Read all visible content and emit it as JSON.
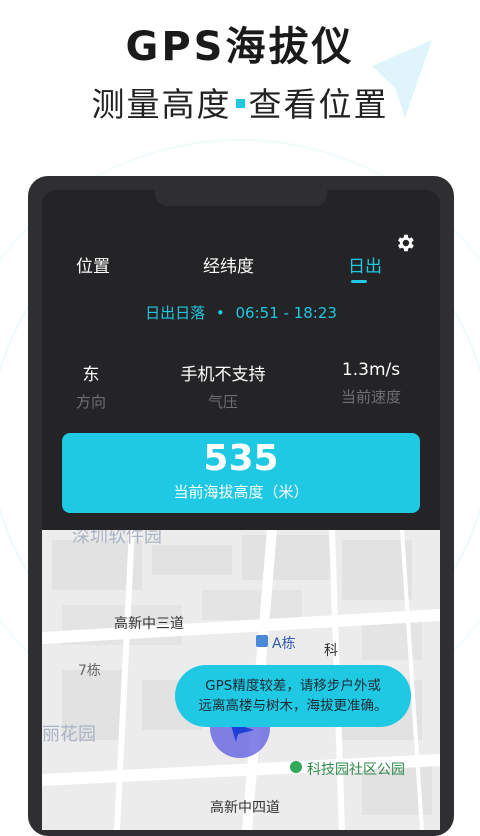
{
  "promo": {
    "headline": "GPS海拔仪",
    "subline_left": "测量高度",
    "subline_right": "查看位置"
  },
  "tabs": [
    {
      "label": "位置",
      "active": false
    },
    {
      "label": "经纬度",
      "active": false
    },
    {
      "label": "日出",
      "active": true
    }
  ],
  "settings_icon": "gear-icon",
  "sun": {
    "label": "日出日落",
    "separator": "•",
    "times": "06:51 - 18:23"
  },
  "stats": [
    {
      "value": "东",
      "label": "方向"
    },
    {
      "value": "手机不支持",
      "label": "气压"
    },
    {
      "value": "1.3m/s",
      "label": "当前速度"
    }
  ],
  "altitude": {
    "value": "535",
    "label": "当前海拔高度（米）"
  },
  "map": {
    "road_labels": [
      "高新中三道",
      "高新中四道",
      "科"
    ],
    "poi_building": "A栋",
    "poi_park": "科技园社区公园",
    "faded_top": "深圳软件园",
    "faded_garden": "丽花园",
    "block_number": "7栋"
  },
  "toast": {
    "line1": "GPS精度较差，请移步户外或",
    "line2": "远离高楼与树木，海拔更准确。"
  },
  "colors": {
    "accent": "#1fc8e3",
    "screen_bg": "#242426",
    "frame": "#2f2f31",
    "map_bg": "#eeeeee"
  }
}
